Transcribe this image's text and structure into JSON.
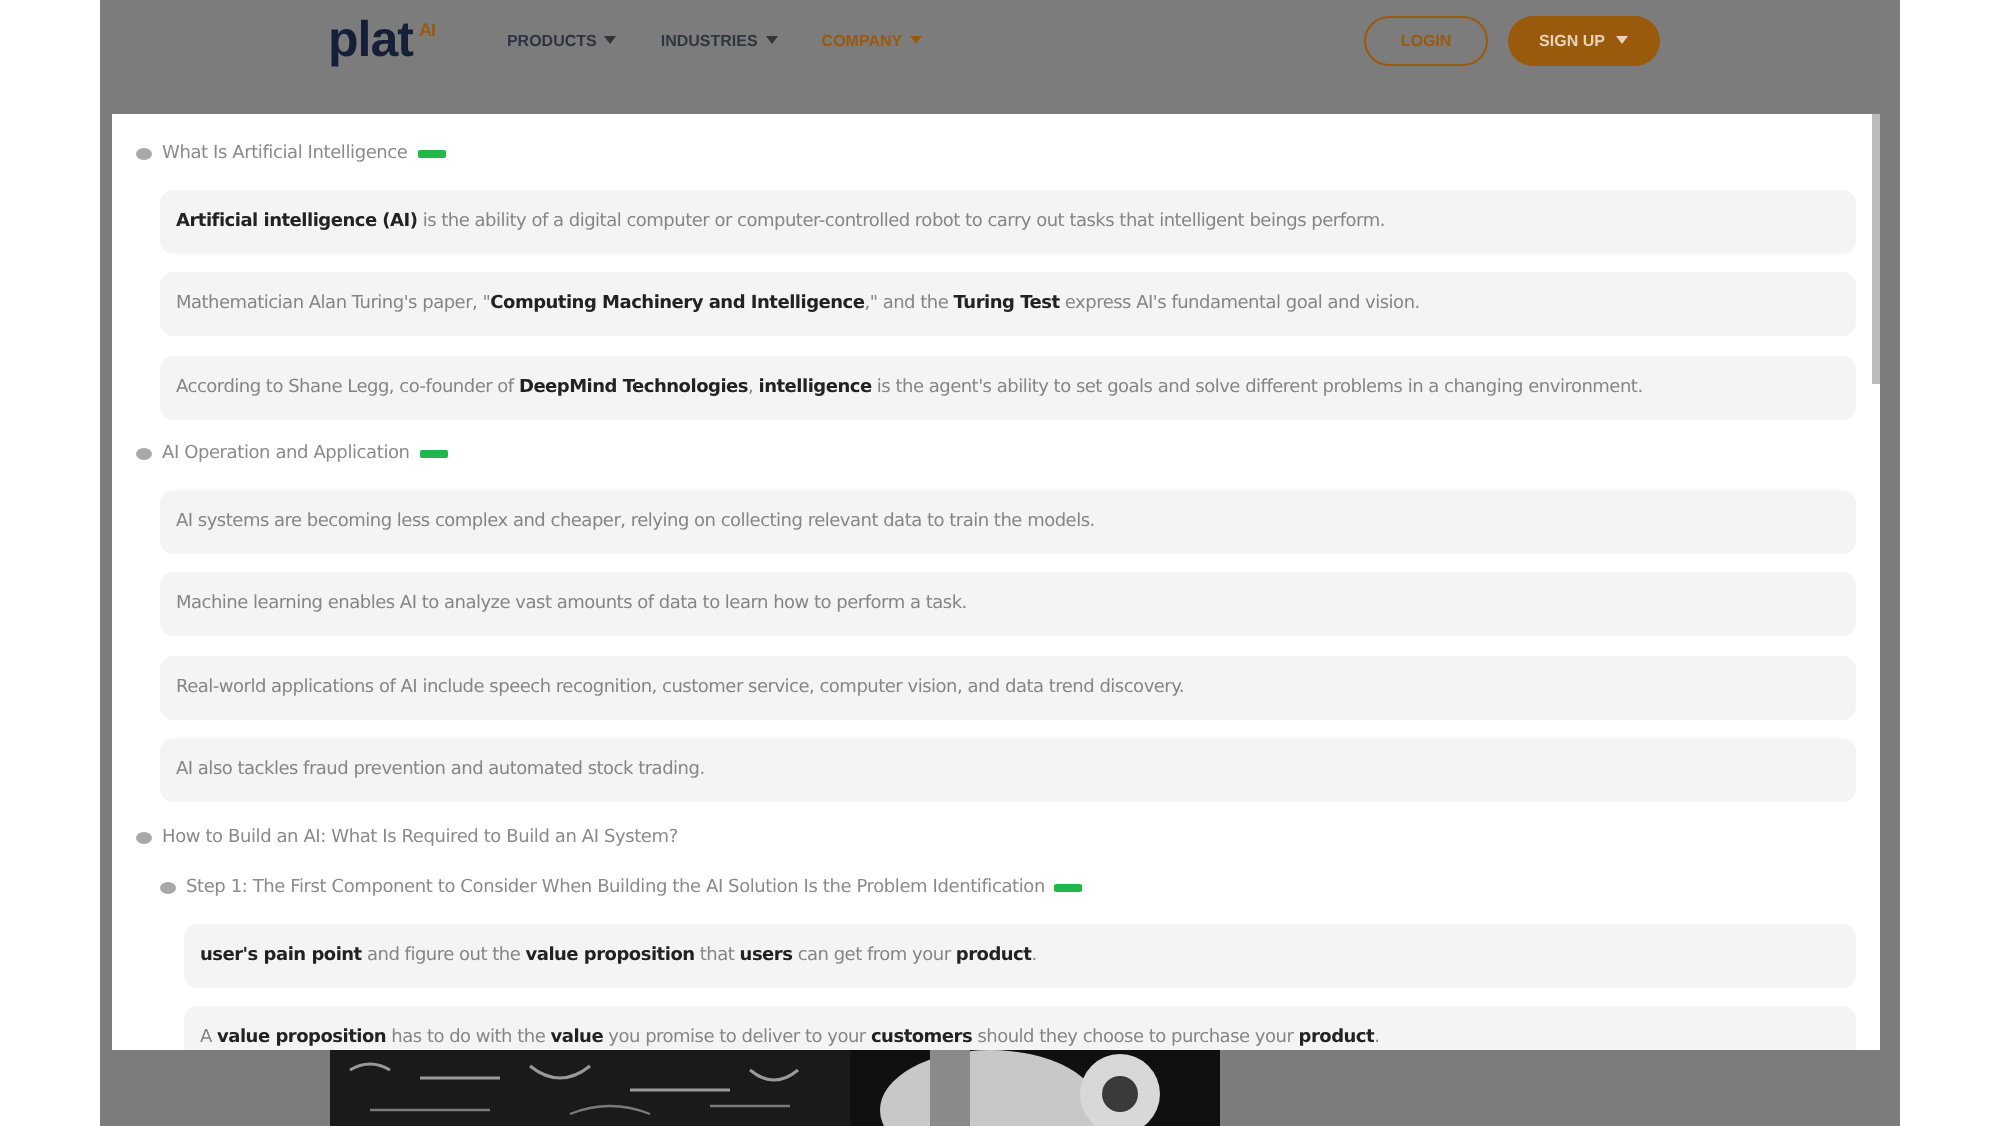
{
  "header": {
    "logo": {
      "text": "plat",
      "superscript": "AI"
    },
    "nav": [
      {
        "label": "PRODUCTS",
        "selected": false
      },
      {
        "label": "INDUSTRIES",
        "selected": false
      },
      {
        "label": "COMPANY",
        "selected": true
      }
    ],
    "login": "LOGIN",
    "signup": "SIGN UP"
  },
  "outline": [
    {
      "kind": "heading",
      "title": "What Is Artificial Intelligence",
      "marked": true,
      "children": [
        {
          "kind": "card",
          "text": "**Artificial intelligence (AI)** is the ability of a digital computer or computer-controlled robot to carry out tasks that intelligent beings perform."
        },
        {
          "kind": "card",
          "text": "Mathematician Alan Turing's paper, \"**Computing Machinery and Intelligence**,\" and the **Turing Test** express AI's fundamental goal and vision."
        },
        {
          "kind": "card",
          "text": "According to Shane Legg, co-founder of **DeepMind Technologies**, **intelligence** is the agent's ability to set goals and solve different problems in a changing environment."
        }
      ]
    },
    {
      "kind": "heading",
      "title": "AI Operation and Application",
      "marked": true,
      "children": [
        {
          "kind": "card",
          "text": "AI systems are becoming less complex and cheaper, relying on collecting relevant data to train the models."
        },
        {
          "kind": "card",
          "text": "Machine learning enables AI to analyze vast amounts of data to learn how to perform a task."
        },
        {
          "kind": "card",
          "text": "Real-world applications of AI include speech recognition, customer service, computer vision, and data trend discovery."
        },
        {
          "kind": "card",
          "text": "AI also tackles fraud prevention and automated stock trading."
        }
      ]
    },
    {
      "kind": "heading",
      "title": "How to Build an AI: What Is Required to Build an AI System?",
      "marked": false,
      "children": [
        {
          "kind": "heading",
          "title": "Step 1: The First Component to Consider When Building the AI Solution Is the Problem Identification",
          "marked": true,
          "children": [
            {
              "kind": "card",
              "text": "**user's pain point** and figure out the **value proposition** that **users** can get from your **product**."
            },
            {
              "kind": "card",
              "text": "A **value proposition** has to do with the **value** you promise to deliver to your **customers** should they choose to purchase your **product**."
            }
          ]
        }
      ]
    }
  ]
}
